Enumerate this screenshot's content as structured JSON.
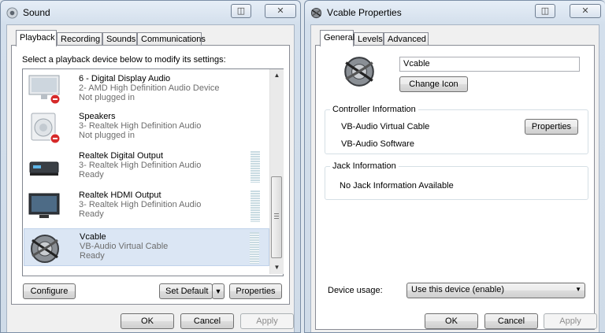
{
  "sound_window": {
    "title": "Sound",
    "tabs": [
      "Playback",
      "Recording",
      "Sounds",
      "Communications"
    ],
    "instruction": "Select a playback device below to modify its settings:",
    "devices": [
      {
        "name": "6 - Digital Display Audio",
        "sub": "2- AMD High Definition Audio Device",
        "status": "Not plugged in",
        "icon": "monitor-unplugged-icon"
      },
      {
        "name": "Speakers",
        "sub": "3- Realtek High Definition Audio",
        "status": "Not plugged in",
        "icon": "speaker-unplugged-icon"
      },
      {
        "name": "Realtek Digital Output",
        "sub": "3- Realtek High Definition Audio",
        "status": "Ready",
        "icon": "digital-output-icon"
      },
      {
        "name": "Realtek HDMI Output",
        "sub": "3- Realtek High Definition Audio",
        "status": "Ready",
        "icon": "hdmi-monitor-icon"
      },
      {
        "name": "Vcable",
        "sub": "VB-Audio Virtual Cable",
        "status": "Ready",
        "icon": "vcable-icon"
      }
    ],
    "buttons": {
      "configure": "Configure",
      "set_default": "Set Default",
      "properties": "Properties",
      "ok": "OK",
      "cancel": "Cancel",
      "apply": "Apply"
    }
  },
  "props_window": {
    "title": "Vcable Properties",
    "tabs": [
      "General",
      "Levels",
      "Advanced"
    ],
    "device_name_value": "Vcable",
    "change_icon_label": "Change Icon",
    "controller": {
      "title": "Controller Information",
      "name": "VB-Audio Virtual Cable",
      "vendor": "VB-Audio Software",
      "properties_label": "Properties"
    },
    "jack": {
      "title": "Jack Information",
      "text": "No Jack Information Available"
    },
    "device_usage": {
      "label": "Device usage:",
      "value": "Use this device (enable)"
    },
    "buttons": {
      "ok": "OK",
      "cancel": "Cancel",
      "apply": "Apply"
    }
  }
}
